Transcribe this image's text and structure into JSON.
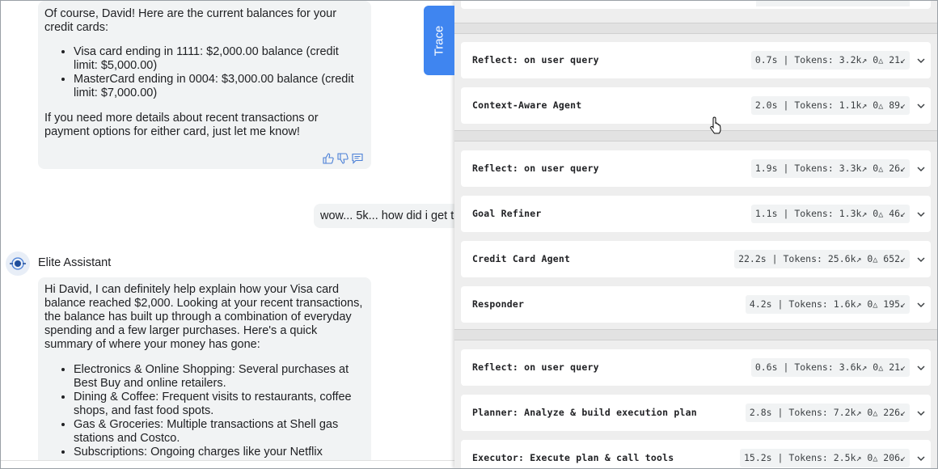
{
  "chat": {
    "message1": {
      "intro": "Of course, David! Here are the current balances for your credit cards:",
      "items": [
        "Visa card ending in 1111: $2,000.00 balance (credit limit: $5,000.00)",
        "MasterCard ending in 0004: $3,000.00 balance (credit limit: $7,000.00)"
      ],
      "outro": "If you need more details about recent transactions or payment options for either card, just let me know!"
    },
    "user_message": "wow... 5k... how did i get this",
    "assistant_name": "Elite Assistant",
    "message2": {
      "intro": "Hi David, I can definitely help explain how your Visa card balance reached $2,000. Looking at your recent transactions, the balance has built up through a combination of everyday spending and a few larger purchases. Here's a quick summary of where your money has gone:",
      "items": [
        "Electronics & Online Shopping: Several purchases at Best Buy and online retailers.",
        "Dining & Coffee: Frequent visits to restaurants, coffee shops, and fast food spots.",
        "Gas & Groceries: Multiple transactions at Shell gas stations and Costco.",
        "Subscriptions: Ongoing charges like your Netflix"
      ]
    }
  },
  "trace_tab_label": "Trace",
  "trace": {
    "rows": [
      {
        "name": "Reflect: on user query",
        "time": "0.7s",
        "tokens": "3.2k",
        "up": "0",
        "down": "21"
      },
      {
        "name": "Context-Aware Agent",
        "time": "2.0s",
        "tokens": "1.1k",
        "up": "0",
        "down": "89"
      },
      {
        "name": "Reflect: on user query",
        "time": "1.9s",
        "tokens": "3.3k",
        "up": "0",
        "down": "26"
      },
      {
        "name": "Goal Refiner",
        "time": "1.1s",
        "tokens": "1.3k",
        "up": "0",
        "down": "46"
      },
      {
        "name": "Credit Card Agent",
        "time": "22.2s",
        "tokens": "25.6k",
        "up": "0",
        "down": "652"
      },
      {
        "name": "Responder",
        "time": "4.2s",
        "tokens": "1.6k",
        "up": "0",
        "down": "195"
      },
      {
        "name": "Reflect: on user query",
        "time": "0.6s",
        "tokens": "3.6k",
        "up": "0",
        "down": "21"
      },
      {
        "name": "Planner: Analyze & build execution plan",
        "time": "2.8s",
        "tokens": "7.2k",
        "up": "0",
        "down": "226"
      },
      {
        "name": "Executor: Execute plan & call tools",
        "time": "15.2s",
        "tokens": "2.5k",
        "up": "0",
        "down": "206"
      }
    ],
    "tokens_label": "Tokens:"
  }
}
